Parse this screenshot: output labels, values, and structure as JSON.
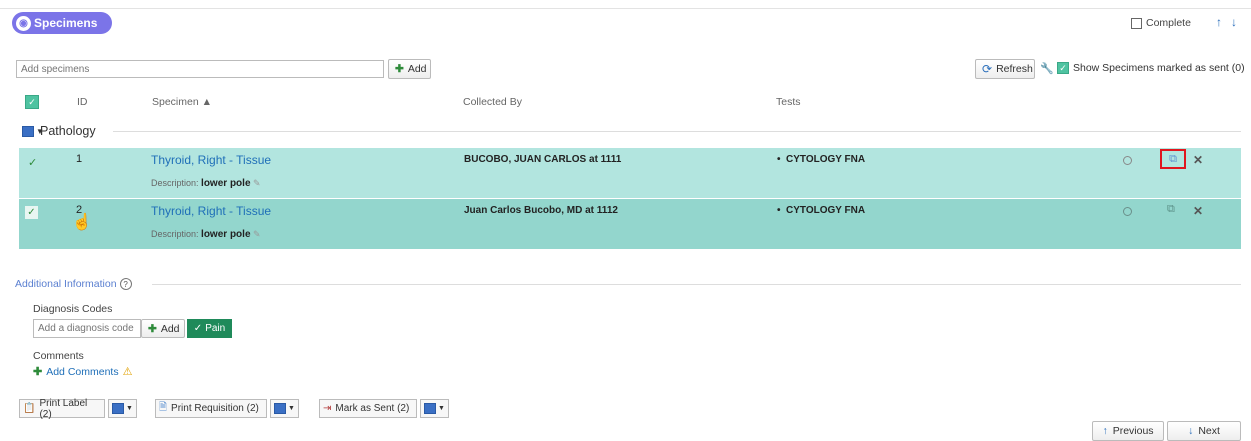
{
  "header": {
    "title": "Specimens",
    "complete_label": "Complete"
  },
  "toolbar": {
    "add_placeholder": "Add specimens",
    "add_label": "Add",
    "refresh_label": "Refresh",
    "show_sent_label": "Show Specimens marked as sent (0)"
  },
  "columns": {
    "id": "ID",
    "specimen": "Specimen ▲",
    "collected_by": "Collected By",
    "tests": "Tests"
  },
  "group": {
    "name": "Pathology"
  },
  "rows": [
    {
      "id": "1",
      "specimen": "Thyroid, Right - Tissue",
      "desc_label": "Description:",
      "desc_value": "lower pole",
      "collected_by": "BUCOBO, JUAN CARLOS at 1111",
      "test": "CYTOLOGY FNA"
    },
    {
      "id": "2",
      "specimen": "Thyroid, Right - Tissue",
      "desc_label": "Description:",
      "desc_value": "lower pole",
      "collected_by": "Juan Carlos Bucobo, MD at 1112",
      "test": "CYTOLOGY FNA"
    }
  ],
  "additional": {
    "title": "Additional Information",
    "diagnosis_label": "Diagnosis Codes",
    "diagnosis_placeholder": "Add a diagnosis code",
    "add_label": "Add",
    "tag_label": "Pain",
    "comments_label": "Comments",
    "add_comments_label": "Add Comments"
  },
  "actions": {
    "print_label": "Print Label (2)",
    "print_requisition": "Print Requisition (2)",
    "mark_sent": "Mark as Sent (2)"
  },
  "nav": {
    "previous": "Previous",
    "next": "Next"
  },
  "colors": {
    "accent": "#7b74e8",
    "row_light": "#b2e5df",
    "row_dark": "#93d6cd",
    "link": "#1f6fb8",
    "pain_tag": "#1f8a5a",
    "highlight": "#e0161e"
  },
  "icons": [
    "help-circle-icon",
    "warning-icon",
    "copy-icon",
    "wrench-icon",
    "refresh-icon",
    "pencil-icon",
    "close-icon",
    "hand-cursor-icon"
  ]
}
